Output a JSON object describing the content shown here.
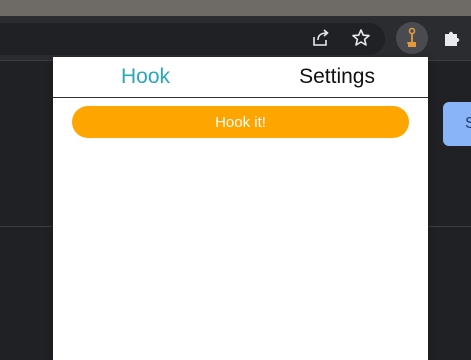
{
  "browser": {
    "icons": {
      "share": "share-icon",
      "star": "bookmark-star-icon",
      "extension": "hook-extension-icon",
      "puzzle": "extensions-puzzle-icon"
    },
    "page_button_label": "S"
  },
  "popup": {
    "tabs": [
      {
        "label": "Hook",
        "active": true
      },
      {
        "label": "Settings",
        "active": false
      }
    ],
    "hook_button_label": "Hook it!",
    "colors": {
      "accent": "#ffa500",
      "active_tab": "#2aa7b8"
    }
  }
}
